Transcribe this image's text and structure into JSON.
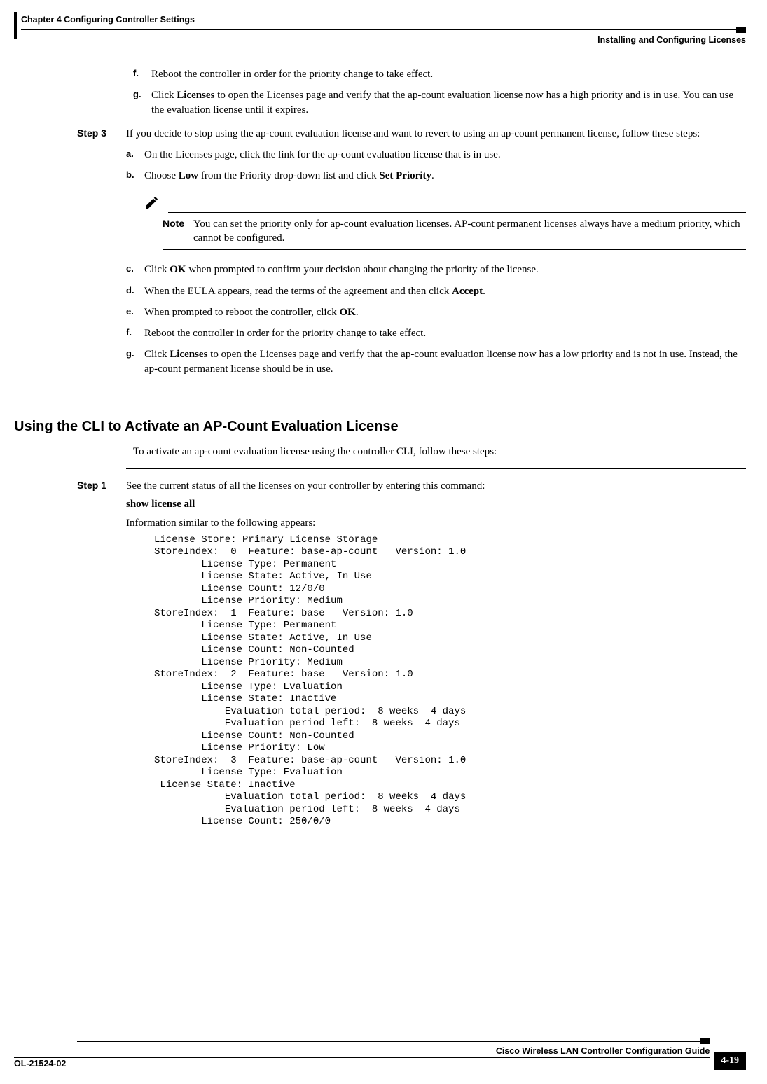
{
  "header": {
    "chapter": "Chapter 4      Configuring Controller Settings",
    "section": "Installing and Configuring Licenses"
  },
  "first_list": {
    "f": "Reboot the controller in order for the priority change to take effect.",
    "g_pre": "Click ",
    "g_b1": "Licenses",
    "g_post": " to open the Licenses page and verify that the ap-count evaluation license now has a high priority and is in use. You can use the evaluation license until it expires."
  },
  "step3": {
    "label": "Step 3",
    "intro": "If you decide to stop using the ap-count evaluation license and want to revert to using an ap-count permanent license, follow these steps:",
    "a": "On the Licenses page, click the link for the ap-count evaluation license that is in use.",
    "b_pre": "Choose ",
    "b_b1": "Low",
    "b_mid": " from the Priority drop-down list and click ",
    "b_b2": "Set Priority",
    "b_post": ".",
    "note_label": "Note",
    "note_text": "You can set the priority only for ap-count evaluation licenses. AP-count permanent licenses always have a medium priority, which cannot be configured.",
    "c_pre": "Click ",
    "c_b1": "OK",
    "c_post": " when prompted to confirm your decision about changing the priority of the license.",
    "d_pre": "When the EULA appears, read the terms of the agreement and then click ",
    "d_b1": "Accept",
    "d_post": ".",
    "e_pre": "When prompted to reboot the controller, click ",
    "e_b1": "OK",
    "e_post": ".",
    "f": "Reboot the controller in order for the priority change to take effect.",
    "g_pre": "Click ",
    "g_b1": "Licenses",
    "g_post": " to open the Licenses page and verify that the ap-count evaluation license now has a low priority and is not in use. Instead, the ap-count permanent license should be in use."
  },
  "section2": {
    "heading": "Using the CLI to Activate an AP-Count Evaluation License",
    "intro": "To activate an ap-count evaluation license using the controller CLI, follow these steps:"
  },
  "step1": {
    "label": "Step 1",
    "line1": "See the current status of all the licenses on your controller by entering this command:",
    "cmd": "show license all",
    "line2": "Information similar to the following appears:",
    "cli": "License Store: Primary License Storage\nStoreIndex:  0  Feature: base-ap-count   Version: 1.0\n        License Type: Permanent\n        License State: Active, In Use\n        License Count: 12/0/0\n        License Priority: Medium\nStoreIndex:  1  Feature: base   Version: 1.0\n        License Type: Permanent\n        License State: Active, In Use\n        License Count: Non-Counted\n        License Priority: Medium\nStoreIndex:  2  Feature: base   Version: 1.0\n        License Type: Evaluation\n        License State: Inactive\n            Evaluation total period:  8 weeks  4 days\n            Evaluation period left:  8 weeks  4 days\n        License Count: Non-Counted\n        License Priority: Low\nStoreIndex:  3  Feature: base-ap-count   Version: 1.0\n        License Type: Evaluation\n License State: Inactive\n            Evaluation total period:  8 weeks  4 days\n            Evaluation period left:  8 weeks  4 days\n        License Count: 250/0/0"
  },
  "footer": {
    "guide": "Cisco Wireless LAN Controller Configuration Guide",
    "docnum": "OL-21524-02",
    "pagenum": "4-19"
  }
}
